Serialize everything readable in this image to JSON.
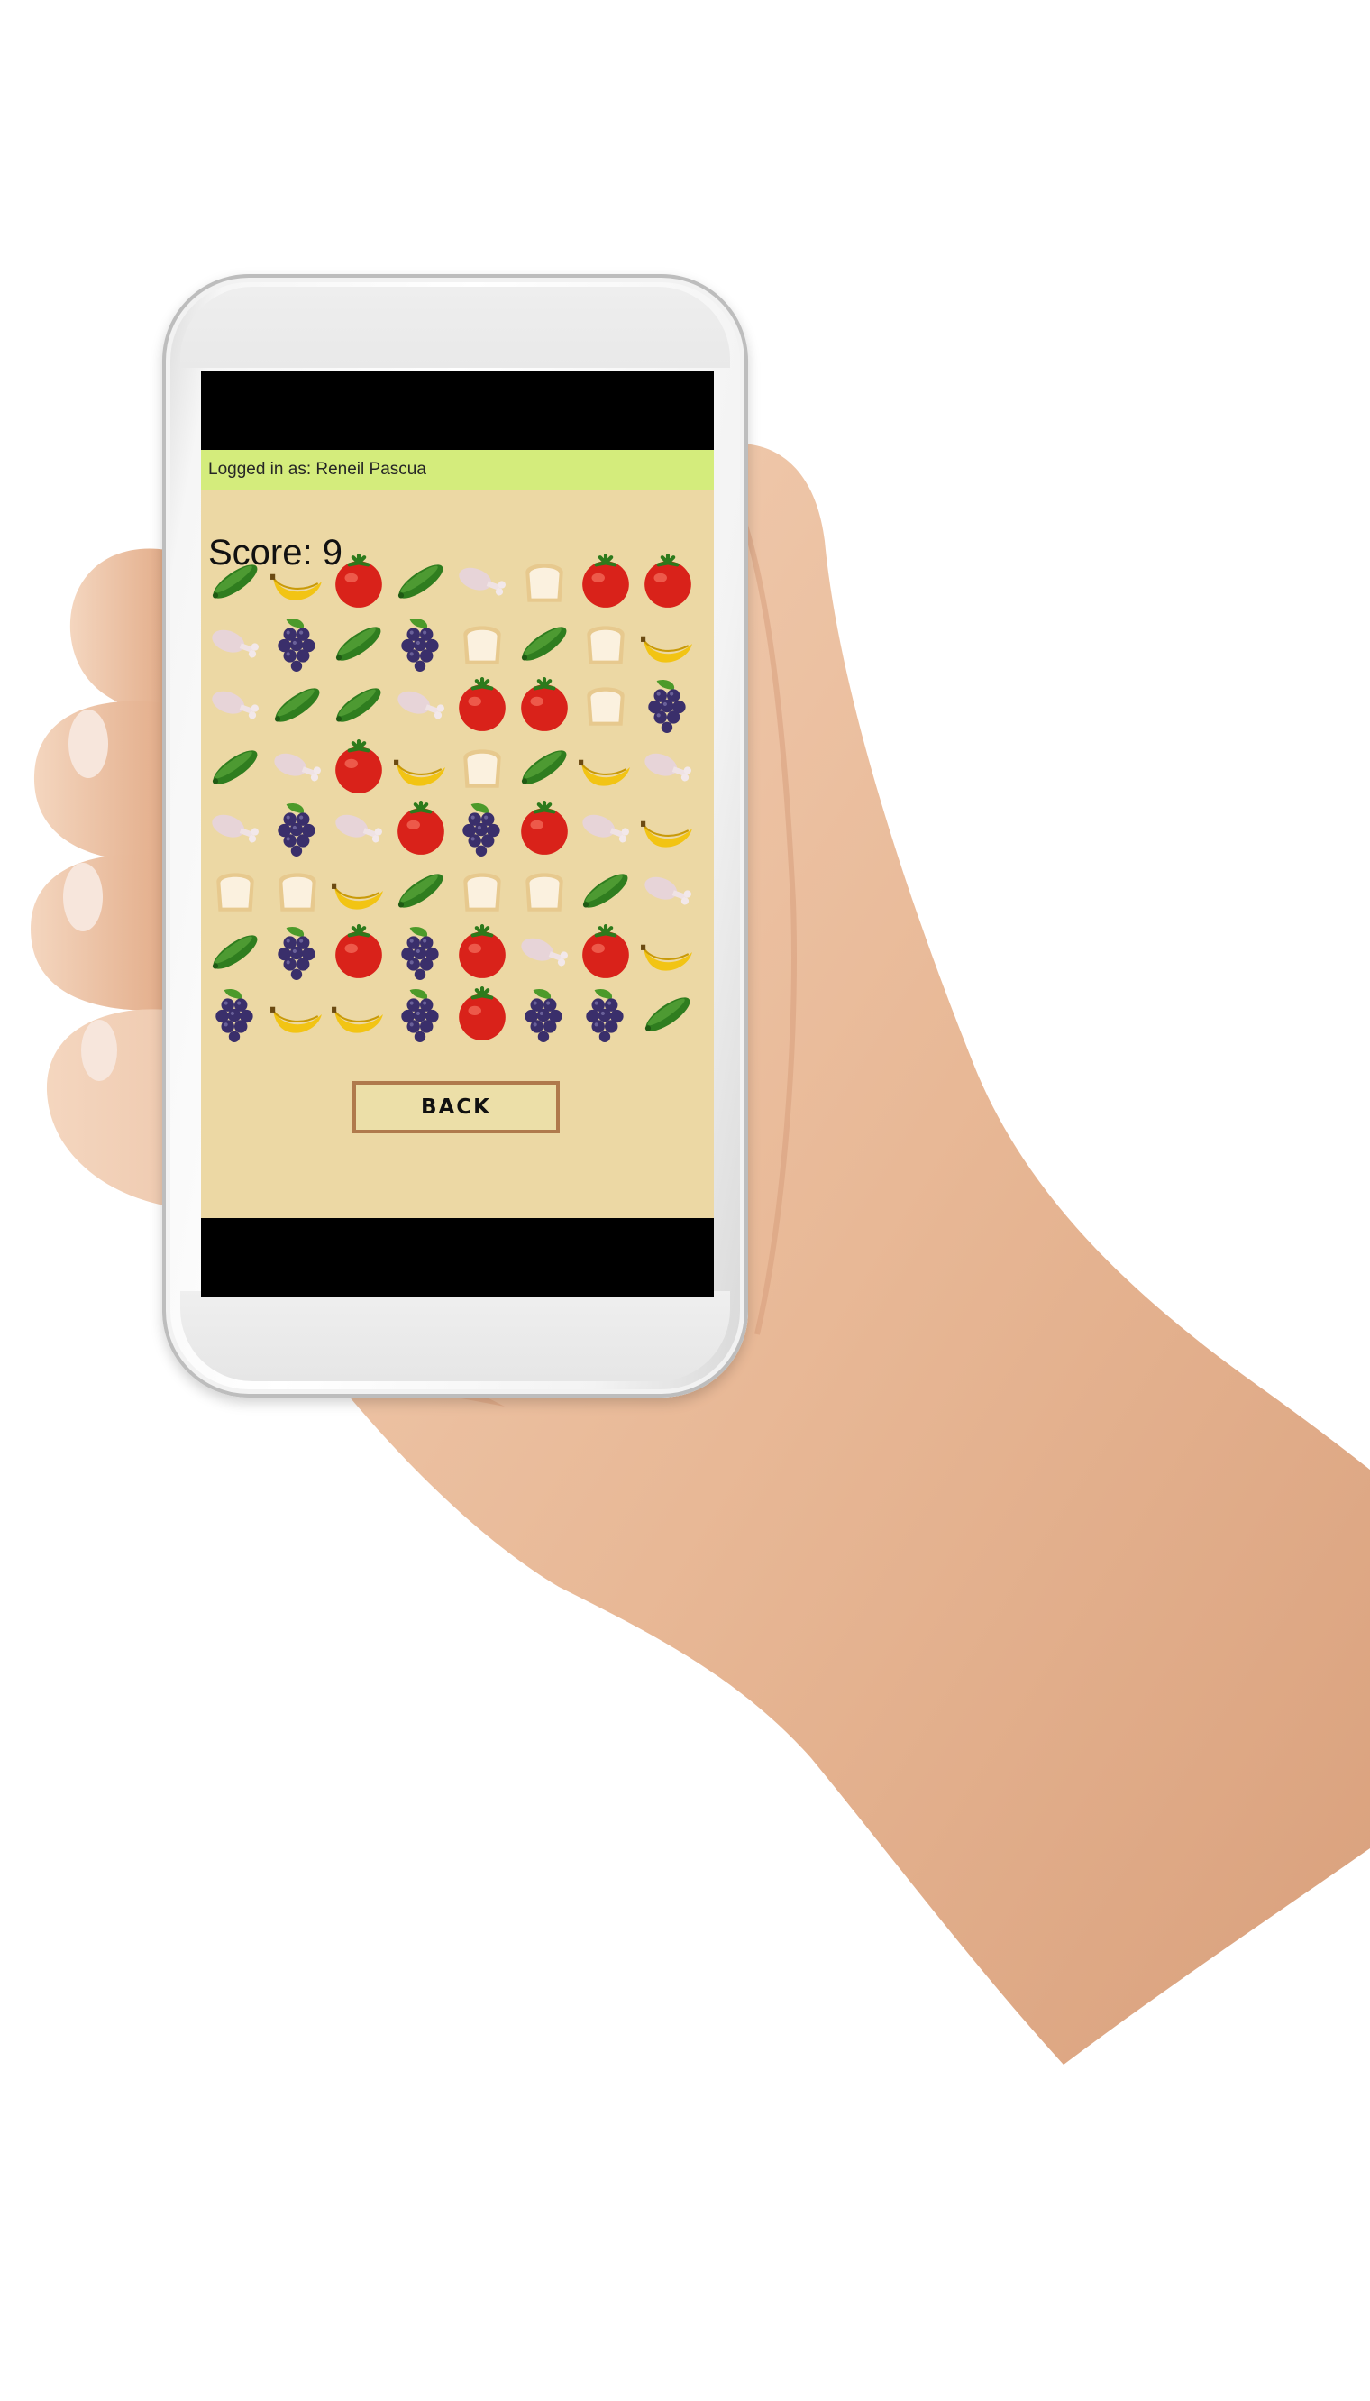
{
  "login": {
    "text": "Logged in as: Reneil Pascua"
  },
  "score": {
    "text": "Score: 9",
    "value": 9
  },
  "board": {
    "rows": [
      [
        "cucumber",
        "banana",
        "tomato",
        "cucumber",
        "chicken",
        "bread",
        "tomato",
        "tomato"
      ],
      [
        "chicken",
        "grapes",
        "cucumber",
        "grapes",
        "bread",
        "cucumber",
        "bread",
        "banana"
      ],
      [
        "chicken",
        "cucumber",
        "cucumber",
        "chicken",
        "tomato",
        "tomato",
        "bread",
        "grapes"
      ],
      [
        "cucumber",
        "chicken",
        "tomato",
        "banana",
        "bread",
        "cucumber",
        "banana",
        "chicken"
      ],
      [
        "chicken",
        "grapes",
        "chicken",
        "tomato",
        "grapes",
        "tomato",
        "chicken",
        "banana"
      ],
      [
        "bread",
        "bread",
        "banana",
        "cucumber",
        "bread",
        "bread",
        "cucumber",
        "chicken"
      ],
      [
        "cucumber",
        "grapes",
        "tomato",
        "grapes",
        "tomato",
        "chicken",
        "tomato",
        "banana"
      ],
      [
        "grapes",
        "banana",
        "banana",
        "grapes",
        "tomato",
        "grapes",
        "grapes",
        "cucumber"
      ]
    ]
  },
  "buttons": {
    "back_label": "BACK"
  },
  "colors": {
    "app_background": "#ecd8a4",
    "header_bar": "#d4ec7c",
    "button_border": "#b07a4c",
    "button_fill": "#ecdfa8"
  }
}
